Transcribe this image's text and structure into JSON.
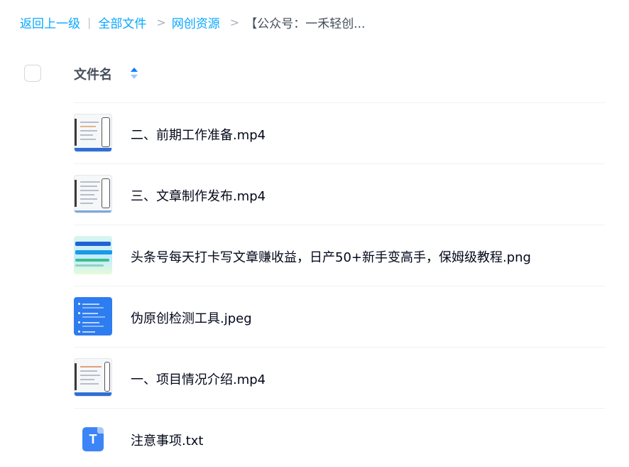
{
  "breadcrumb": {
    "back_label": "返回上一级",
    "separator": "|",
    "arrow": ">",
    "items": [
      "全部文件",
      "网创资源"
    ],
    "current": "【公众号：一禾轻创..."
  },
  "header": {
    "name_label": "文件名",
    "sort_icon": "sort-toggle-icon"
  },
  "files": [
    {
      "name": "二、前期工作准备.mp4",
      "thumb": "video"
    },
    {
      "name": "三、文章制作发布.mp4",
      "thumb": "video"
    },
    {
      "name": "头条号每天打卡写文章赚收益，日产50+新手变高手，保姆级教程.png",
      "thumb": "image"
    },
    {
      "name": "伪原创检测工具.jpeg",
      "thumb": "image"
    },
    {
      "name": "一、项目情况介绍.mp4",
      "thumb": "video"
    },
    {
      "name": "注意事项.txt",
      "thumb": "txt",
      "icon_letter": "T"
    }
  ],
  "colors": {
    "link": "#06a7ff",
    "text": "#03081a",
    "muted": "#454d5a",
    "divider": "#f0f1f3",
    "txt_icon": "#3d84f7"
  }
}
